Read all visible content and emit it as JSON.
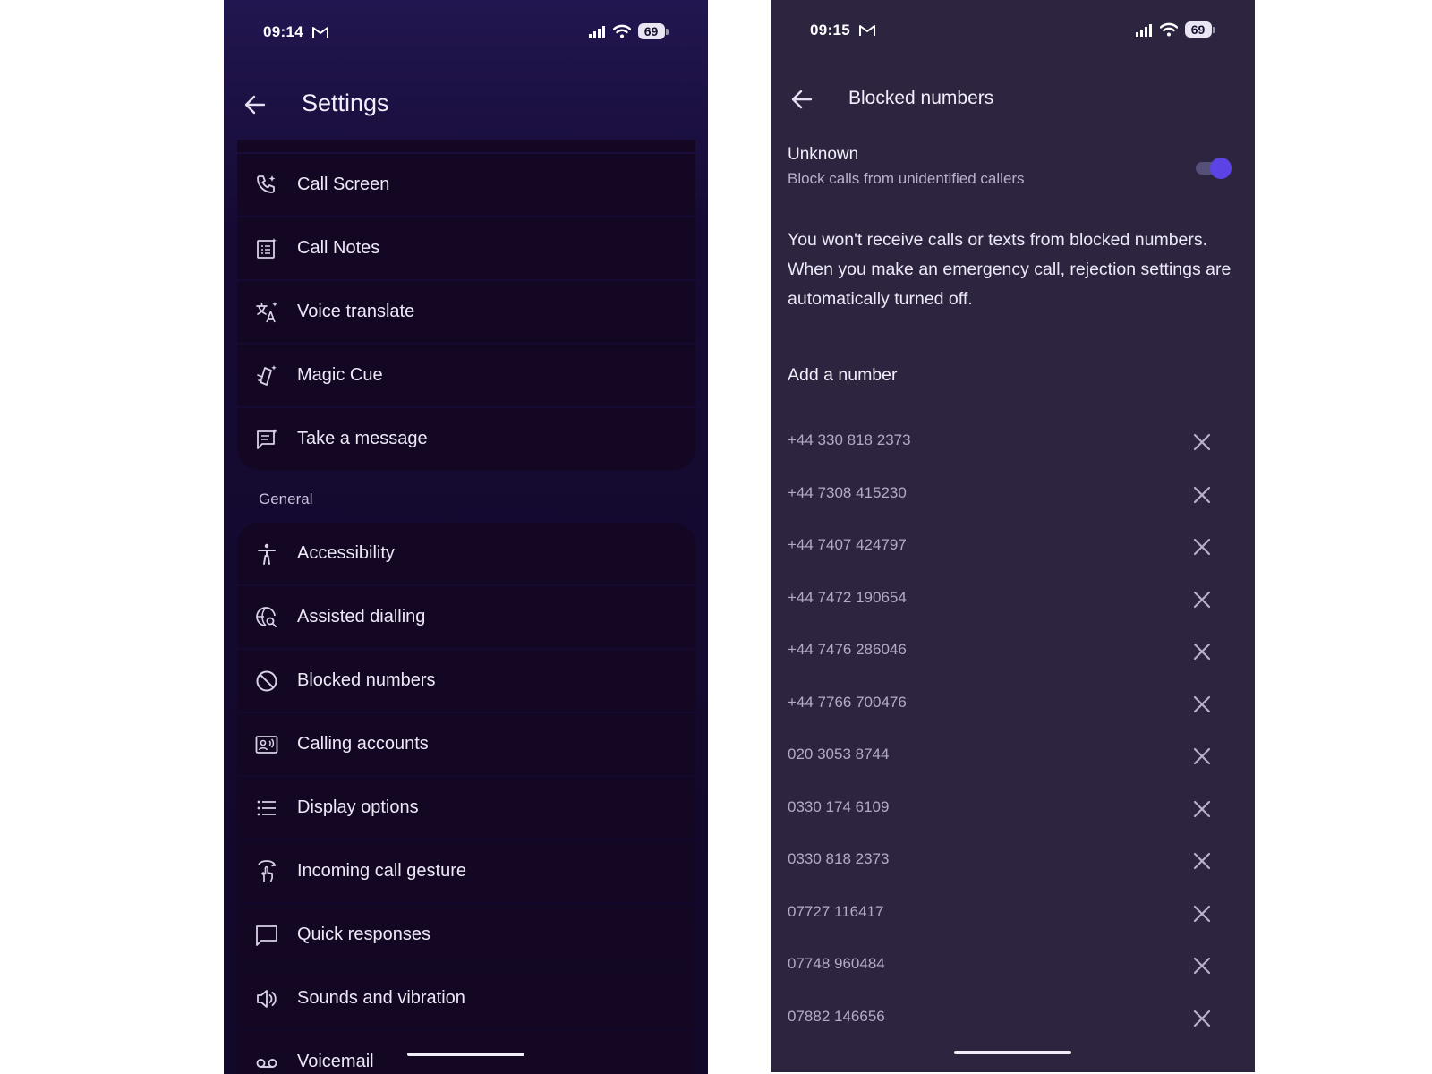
{
  "colors": {
    "left_bg": "#160a33",
    "item_bg": "#130723",
    "right_bg": "#2d2440",
    "accent_toggle": "#5b43e6",
    "text_primary": "#ede9f7",
    "text_secondary": "#b3abc6"
  },
  "left_screen": {
    "status": {
      "time": "09:14",
      "mail_icon": "gmail-icon",
      "battery": "69"
    },
    "title": "Settings",
    "group1": [
      {
        "label": "Call Screen",
        "icon": "call-screen-icon"
      },
      {
        "label": "Call Notes",
        "icon": "call-notes-icon"
      },
      {
        "label": "Voice translate",
        "icon": "translate-icon"
      },
      {
        "label": "Magic Cue",
        "icon": "magic-cue-icon"
      },
      {
        "label": "Take a message",
        "icon": "message-icon"
      }
    ],
    "section_general": "General",
    "general": [
      {
        "label": "Accessibility",
        "icon": "accessibility-icon"
      },
      {
        "label": "Assisted dialling",
        "icon": "globe-search-icon"
      },
      {
        "label": "Blocked numbers",
        "icon": "block-icon"
      },
      {
        "label": "Calling accounts",
        "icon": "contact-card-icon"
      },
      {
        "label": "Display options",
        "icon": "list-icon"
      },
      {
        "label": "Incoming call gesture",
        "icon": "gesture-icon"
      },
      {
        "label": "Quick responses",
        "icon": "chat-bubble-icon"
      },
      {
        "label": "Sounds and vibration",
        "icon": "speaker-icon"
      },
      {
        "label": "Voicemail",
        "icon": "voicemail-icon"
      }
    ]
  },
  "right_screen": {
    "status": {
      "time": "09:15",
      "mail_icon": "gmail-icon",
      "battery": "69"
    },
    "title": "Blocked numbers",
    "unknown": {
      "title": "Unknown",
      "subtitle": "Block calls from unidentified callers",
      "enabled": true
    },
    "info_text": "You won't receive calls or texts from blocked numbers. When you make an emergency call, rejection settings are automatically turned off.",
    "add_number": "Add a number",
    "blocked_numbers": [
      "+44 330 818 2373",
      "+44 7308 415230",
      "+44 7407 424797",
      "+44 7472 190654",
      "+44 7476 286046",
      "+44 7766 700476",
      "020 3053 8744",
      "0330 174 6109",
      "0330 818 2373",
      "07727 116417",
      "07748 960484",
      "07882 146656"
    ]
  }
}
